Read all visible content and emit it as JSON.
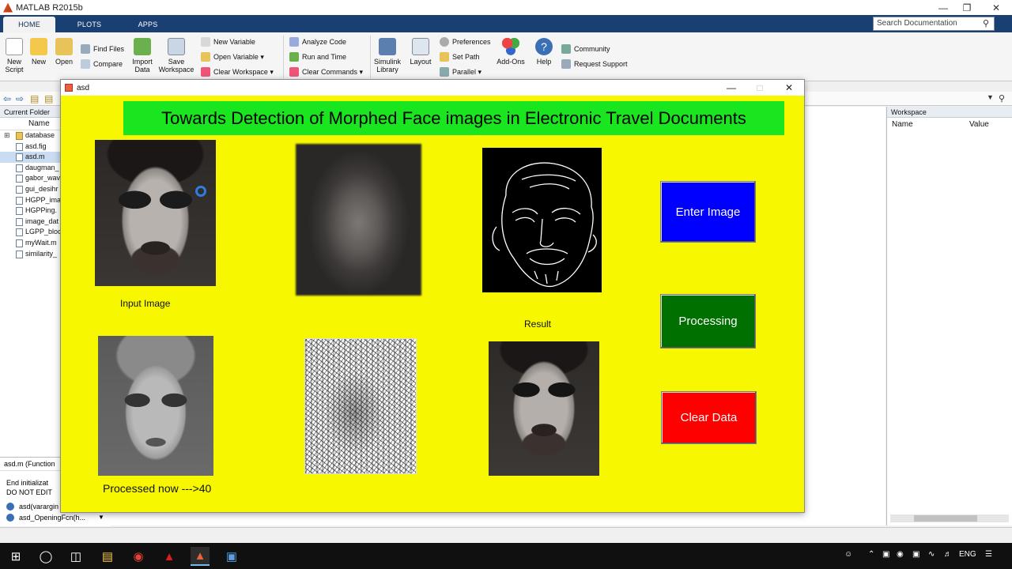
{
  "app": {
    "title": "MATLAB R2015b"
  },
  "ribbon_tabs": [
    {
      "label": "HOME",
      "active": true
    },
    {
      "label": "PLOTS",
      "active": false
    },
    {
      "label": "APPS",
      "active": false
    }
  ],
  "search": {
    "placeholder": "Search Documentation"
  },
  "ribbon": {
    "new_script": "New\nScript",
    "new": "New",
    "open": "Open",
    "find_files": "Find Files",
    "compare": "Compare",
    "import_data": "Import\nData",
    "save_workspace": "Save\nWorkspace",
    "new_variable": "New Variable",
    "open_variable": "Open Variable",
    "clear_workspace": "Clear Workspace",
    "analyze_code": "Analyze Code",
    "run_and_time": "Run and Time",
    "clear_commands": "Clear Commands",
    "simulink_library": "Simulink\nLibrary",
    "layout": "Layout",
    "preferences": "Preferences",
    "set_path": "Set Path",
    "parallel": "Parallel",
    "add_ons": "Add-Ons",
    "help": "Help",
    "community": "Community",
    "request_support": "Request Support"
  },
  "current_folder": {
    "title": "Current Folder",
    "col_name": "Name",
    "files": [
      {
        "name": "database",
        "type": "folder",
        "selected": false
      },
      {
        "name": "asd.fig",
        "type": "file",
        "selected": false
      },
      {
        "name": "asd.m",
        "type": "file",
        "selected": true
      },
      {
        "name": "daugman_",
        "type": "file",
        "selected": false
      },
      {
        "name": "gabor_wav",
        "type": "file",
        "selected": false
      },
      {
        "name": "gui_desihr",
        "type": "file",
        "selected": false
      },
      {
        "name": "HGPP_ima",
        "type": "file",
        "selected": false
      },
      {
        "name": "HGPPing.",
        "type": "file",
        "selected": false
      },
      {
        "name": "image_dat",
        "type": "file",
        "selected": false
      },
      {
        "name": "LGPP_bloc",
        "type": "file",
        "selected": false
      },
      {
        "name": "myWait.m",
        "type": "file",
        "selected": false
      },
      {
        "name": "similarity_",
        "type": "file",
        "selected": false
      }
    ]
  },
  "details": {
    "file_label": "asd.m  (Function",
    "line1": "End initializat",
    "line2": "DO NOT EDIT",
    "fn1": "asd(varargin",
    "fn2": "asd_OpeningFcn(h..."
  },
  "workspace": {
    "title": "Workspace",
    "col_name": "Name",
    "col_value": "Value"
  },
  "figure": {
    "title": "asd",
    "heading": "Towards Detection of Morphed Face images in Electronic Travel Documents",
    "labels": {
      "input_image": "Input Image",
      "result": "Result",
      "processed": "Processed now --->40"
    },
    "buttons": {
      "enter_image": "Enter Image",
      "processing": "Processing",
      "clear_data": "Clear Data"
    }
  },
  "taskbar": {
    "lang": "ENG"
  },
  "colors": {
    "figure_bg": "#f7f700",
    "heading_bg": "#19e61e",
    "enter_image_bg": "#0000ff",
    "processing_bg": "#007000",
    "clear_data_bg": "#ff0000"
  }
}
